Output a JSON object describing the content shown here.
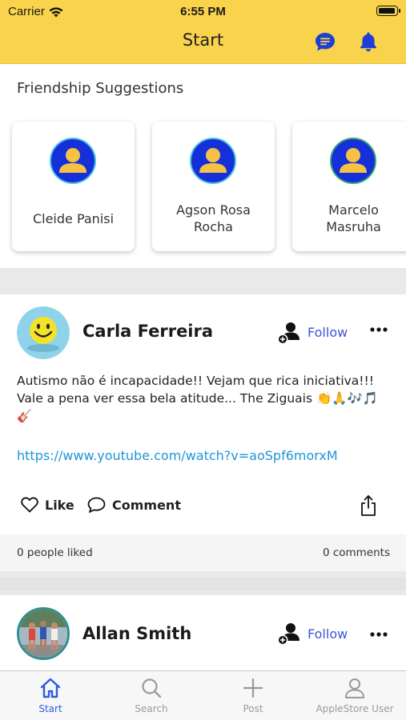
{
  "status_bar": {
    "carrier": "Carrier",
    "time": "6:55 PM"
  },
  "header": {
    "title": "Start",
    "chat_icon": "chat-bubble-icon",
    "bell_icon": "bell-icon",
    "accent": "#f8d34b",
    "icon_color": "#1e3fd6"
  },
  "suggestions": {
    "title": "Friendship Suggestions",
    "people": [
      {
        "name_line1": "Cleide Panisi",
        "name_line2": ""
      },
      {
        "name_line1": "Agson Rosa",
        "name_line2": "Rocha"
      },
      {
        "name_line1": "Marcelo",
        "name_line2": "Masruha"
      }
    ]
  },
  "posts": [
    {
      "author": "Carla Ferreira",
      "follow_label": "Follow",
      "text": "Autismo não é incapacidade!! Vejam que rica iniciativa!!! Vale a pena ver essa bela atitude... The Ziguais 👏🙏🎶🎵🎸",
      "link": "https://www.youtube.com/watch?v=aoSpf6morxM",
      "like_label": "Like",
      "comment_label": "Comment",
      "likes_text": "0 people liked",
      "comments_text": "0 comments"
    },
    {
      "author": "Allan Smith",
      "follow_label": "Follow"
    }
  ],
  "tabs": [
    {
      "label": "Start",
      "icon": "home-icon",
      "active": true
    },
    {
      "label": "Search",
      "icon": "search-icon",
      "active": false
    },
    {
      "label": "Post",
      "icon": "plus-icon",
      "active": false
    },
    {
      "label": "AppleStore User",
      "icon": "user-icon",
      "active": false
    }
  ]
}
